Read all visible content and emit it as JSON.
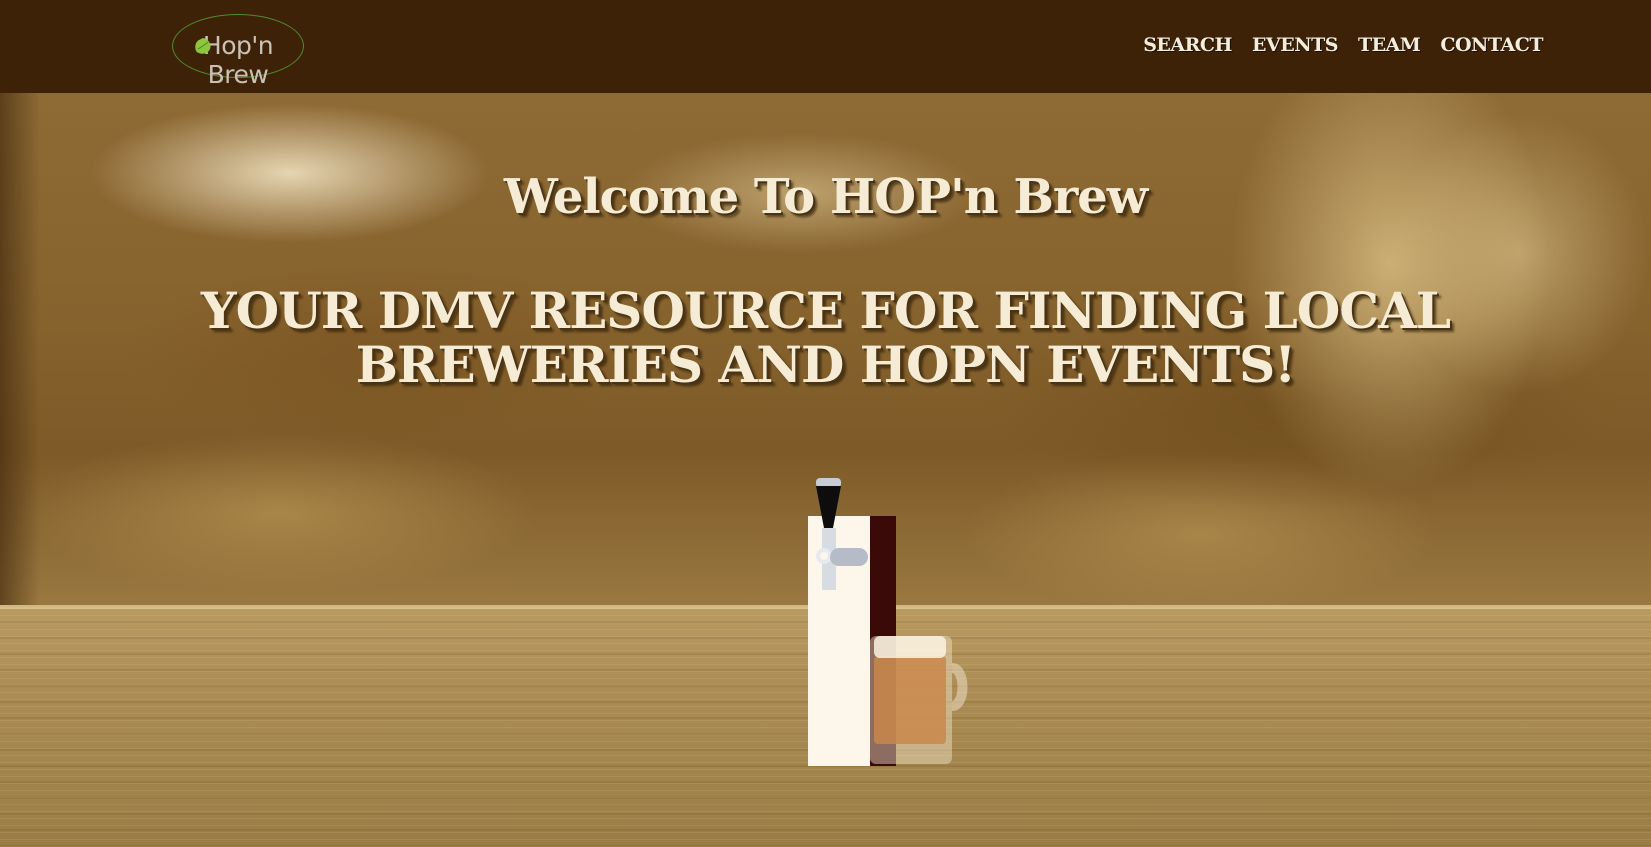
{
  "logo": {
    "text": "Hop'n Brew",
    "icon": "hop-icon"
  },
  "nav": {
    "items": [
      {
        "label": "SEARCH"
      },
      {
        "label": "EVENTS"
      },
      {
        "label": "TEAM"
      },
      {
        "label": "CONTACT"
      }
    ]
  },
  "hero": {
    "welcome": "Welcome To HOP'n Brew",
    "tagline_line1": "YOUR DMV RESOURCE FOR FINDING LOCAL",
    "tagline_line2": "BREWERIES AND HOPN EVENTS!"
  },
  "illustration": {
    "icon": "beer-tap-and-mug-icon"
  },
  "colors": {
    "navbar": "#3e2207",
    "nav_text": "#f3eddd",
    "headline_text": "#f6ecd6",
    "logo_ring": "#4f8a2e",
    "hop_green": "#8cc63f"
  }
}
